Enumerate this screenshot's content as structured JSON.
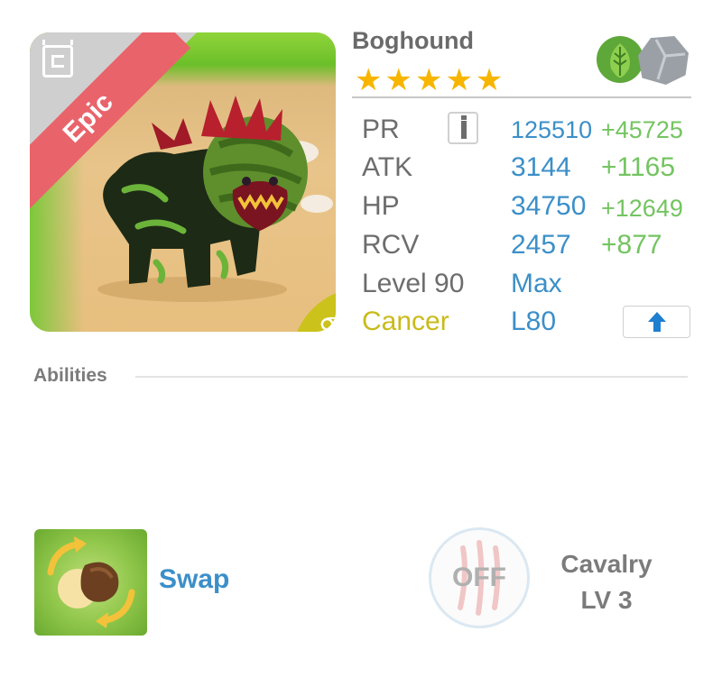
{
  "monster": {
    "rarity": "Epic",
    "name": "Boghound",
    "stars": "★★★★★",
    "star_count": 5,
    "elements": [
      "leaf-icon",
      "stone-icon"
    ],
    "zodiac_symbol": "♋"
  },
  "stats": {
    "pr": {
      "label": "PR",
      "value": "125510",
      "bonus": "+45725"
    },
    "atk": {
      "label": "ATK",
      "value": "3144",
      "bonus": "+1165"
    },
    "hp": {
      "label": "HP",
      "value": "34750",
      "bonus": "+12649"
    },
    "rcv": {
      "label": "RCV",
      "value": "2457",
      "bonus": "+877"
    },
    "level": {
      "label": "Level 90",
      "value": "Max"
    },
    "sign": {
      "label": "Cancer",
      "value": "L80"
    }
  },
  "abilities": {
    "section_title": "Abilities",
    "active": {
      "name": "Swap",
      "icon": "swap-icon"
    },
    "passive": {
      "status": "OFF",
      "name": "Cavalry",
      "level": "LV 3"
    }
  },
  "colors": {
    "epic": "#e9636b",
    "star": "#f7b500",
    "stat_value": "#3c8fc8",
    "stat_bonus": "#74c461",
    "zodiac": "#cbc21b"
  }
}
